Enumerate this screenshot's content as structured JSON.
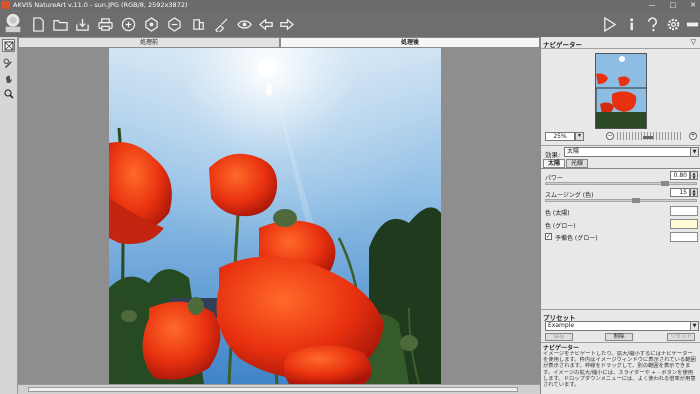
{
  "window": {
    "title": "AKVIS NatureArt v.11.0 - sun.JPG (RGB/8, 2592x3872)",
    "min_glyph": "—",
    "max_glyph": "□",
    "close_glyph": "✕"
  },
  "toolbar": {
    "icons": [
      "new-file",
      "open-file",
      "save-file",
      "print",
      "share",
      "batch",
      "before-after",
      "plugin",
      "undo",
      "redo",
      "run",
      "info",
      "help",
      "settings",
      "menu"
    ]
  },
  "left_tools": [
    "select-tool",
    "pencil-tool",
    "hand-tool",
    "zoom-tool"
  ],
  "view_tabs": {
    "before": "処理前",
    "after": "処理後"
  },
  "right_panel": {
    "navigator_title": "ナビゲーター",
    "collapse_glyph": "▽",
    "zoom": {
      "value": "25%",
      "minus": "−",
      "plus": "+"
    },
    "effect": {
      "label": "効果:",
      "selected": "太陽"
    },
    "param_tabs": [
      "太陽",
      "光線"
    ],
    "params": {
      "power": {
        "label": "パワー",
        "value": "0.80",
        "fraction": 0.8
      },
      "smoothing": {
        "label": "スムージング (色)",
        "value": "15",
        "fraction": 0.6
      },
      "color_sun": {
        "label": "色 (太陽)",
        "swatch": "#ffffff"
      },
      "color_glow": {
        "label": "色 (グロー)",
        "swatch": "#fffbd5"
      },
      "spare_color": {
        "label": "予備色 (グロー)",
        "checked": "✓",
        "swatch": "#ffffff"
      }
    },
    "preset": {
      "title": "プリセット",
      "selected": "Example",
      "save": "保存",
      "delete": "削除",
      "reset": "リセット"
    },
    "help": {
      "title": "ナビゲーター",
      "text": "イメージをナビゲートしたり、拡大/縮小するにはナビゲーターを使用します。枠内はイメージウィンドウに表示されている範囲が表示されます。枠線をドラッグして、別の範囲を表示できます。イメージの拡大/縮小には、スライダーや + - ボタンを使用します。ドロップダウンメニューには、よく使われる倍率が用意されています。"
    },
    "colors": {
      "accent": "#d9532c"
    }
  }
}
